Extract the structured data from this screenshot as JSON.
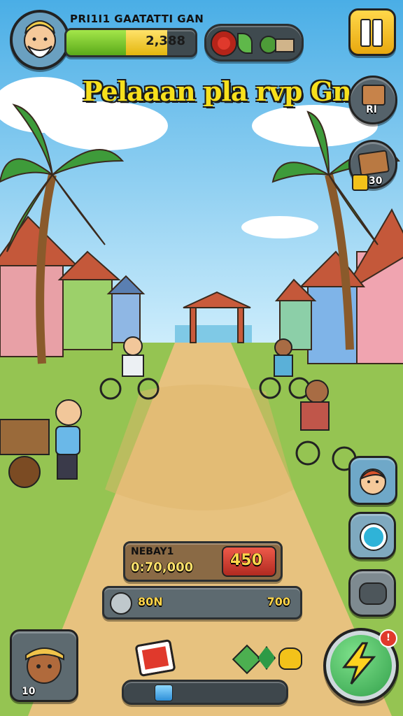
{
  "player": {
    "name": "PRI1I1 GAATATTI GAN",
    "xp_value": "2,388",
    "xp_fraction": 0.78,
    "avatar_icon": "old-man-avatar-icon"
  },
  "resources": {
    "items": [
      "donut-icon",
      "leaf-icon",
      "plants-icon"
    ]
  },
  "pause_icon": "pause-icon",
  "title_banner": "Pelaaan pla rvp Gne!",
  "side_buttons": {
    "shop_label": "RI",
    "chest_label": "30"
  },
  "earnings": {
    "label": "NEBAY1",
    "amount": "0:70,000",
    "price": "450"
  },
  "progress_bar": {
    "left": "80N",
    "right": "700"
  },
  "bottom_progress_fraction": 0.1,
  "char_card_label": "10",
  "colors": {
    "sky": "#5bb7ea",
    "path": "#e7c27f",
    "grass": "#8cc34a",
    "xp_green": "#7ed321",
    "xp_yellow": "#f5d020",
    "price_red": "#d63b2f",
    "gold": "#f3c21a"
  }
}
